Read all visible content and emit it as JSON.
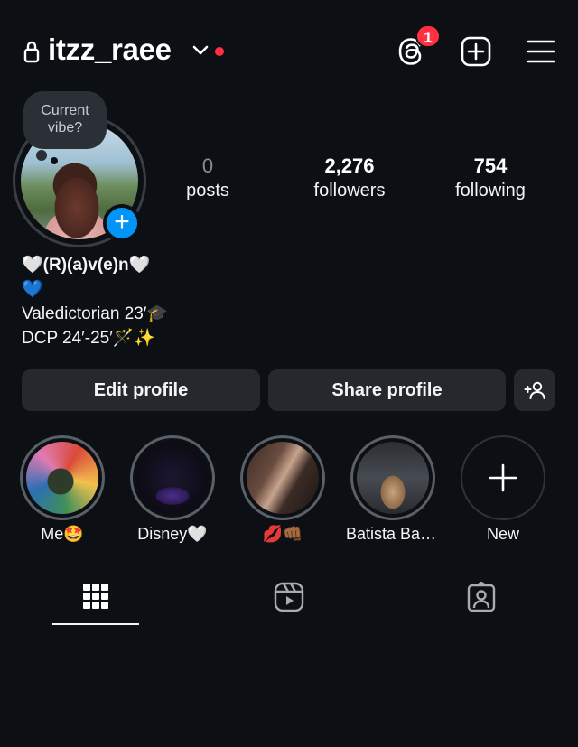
{
  "header": {
    "username": "itzz_raee",
    "notification_count": "1",
    "has_live_dot": true
  },
  "profile": {
    "vibe_prompt": "Current vibe?",
    "stats": [
      {
        "value": "0",
        "label": "posts"
      },
      {
        "value": "2,276",
        "label": "followers"
      },
      {
        "value": "754",
        "label": "following"
      }
    ],
    "bio": {
      "name_line": "🤍(R)(a)v(e)n🤍",
      "line2": "💙",
      "line3": "Valedictorian 23′🎓",
      "line4": "DCP 24′-25′🪄✨"
    }
  },
  "actions": {
    "edit_label": "Edit profile",
    "share_label": "Share profile"
  },
  "highlights": [
    {
      "label": "Me🤩"
    },
    {
      "label": "Disney🤍"
    },
    {
      "label": "💋👊🏾"
    },
    {
      "label": "Batista Bari..."
    },
    {
      "label": "New"
    }
  ],
  "tabs": [
    "grid",
    "reels",
    "tagged"
  ],
  "colors": {
    "background": "#0c1014",
    "accent_blue": "#0095f6",
    "badge_red": "#ff3040",
    "button_bg": "#25292e"
  }
}
